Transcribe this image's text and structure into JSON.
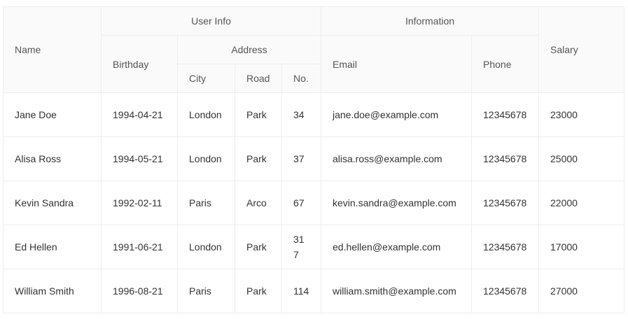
{
  "headers": {
    "name": "Name",
    "user_info": "User Info",
    "birthday": "Birthday",
    "address": "Address",
    "city": "City",
    "road": "Road",
    "no": "No.",
    "information": "Information",
    "email": "Email",
    "phone": "Phone",
    "salary": "Salary"
  },
  "rows": [
    {
      "name": "Jane Doe",
      "birthday": "1994-04-21",
      "city": "London",
      "road": "Park",
      "no": "34",
      "email": "jane.doe@example.com",
      "phone": "12345678",
      "salary": "23000"
    },
    {
      "name": "Alisa Ross",
      "birthday": "1994-05-21",
      "city": "London",
      "road": "Park",
      "no": "37",
      "email": "alisa.ross@example.com",
      "phone": "12345678",
      "salary": "25000"
    },
    {
      "name": "Kevin Sandra",
      "birthday": "1992-02-11",
      "city": "Paris",
      "road": "Arco",
      "no": "67",
      "email": "kevin.sandra@example.com",
      "phone": "12345678",
      "salary": "22000"
    },
    {
      "name": "Ed Hellen",
      "birthday": "1991-06-21",
      "city": "London",
      "road": "Park",
      "no": "317",
      "email": "ed.hellen@example.com",
      "phone": "12345678",
      "salary": "17000"
    },
    {
      "name": "William Smith",
      "birthday": "1996-08-21",
      "city": "Paris",
      "road": "Park",
      "no": "114",
      "email": "william.smith@example.com",
      "phone": "12345678",
      "salary": "27000"
    }
  ]
}
